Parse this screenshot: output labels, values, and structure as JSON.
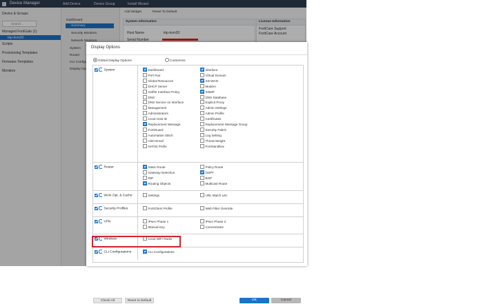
{
  "topbar": {
    "app_title": "Device Manager",
    "menus": [
      "Add Device",
      "Device Group",
      "Install Wizard"
    ]
  },
  "leftnav": {
    "group_header": "Device & Groups",
    "search_placeholder": "Search...",
    "managed": "Managed FortiGate (1)",
    "device": "trip-kvm20",
    "items": [
      "Scripts",
      "Provisioning Templates",
      "Firmware Templates",
      "Monitors"
    ]
  },
  "midnav": {
    "header": "Dashboard",
    "selected": "Summary",
    "items": [
      "Security Monitors",
      "Network Monitors",
      "System",
      "Router",
      "CLI Configurations",
      "Display Options"
    ]
  },
  "content": {
    "add_widget": "Add Widget",
    "reset": "Reset To Default",
    "sysinfo_title": "System Information",
    "host_label": "Host Name",
    "host_value": "trip-kvm20",
    "serial_label": "Serial Number",
    "license_title": "License Information",
    "fortcare_support": "FortiCare Support",
    "fortcare_account": "FortiCare Account"
  },
  "dialog": {
    "title": "Display Options",
    "radio_global": "Global Display Options",
    "radio_custom": "Customize",
    "categories": [
      {
        "name": "System",
        "checked": true,
        "col1": [
          {
            "label": "Dashboard",
            "checked": true
          },
          {
            "label": "Port Pair",
            "checked": false
          },
          {
            "label": "Global Resources",
            "checked": false
          },
          {
            "label": "DHCP Server",
            "checked": false
          },
          {
            "label": "Sniffer Interface Policy",
            "checked": false
          },
          {
            "label": "DNS",
            "checked": false
          },
          {
            "label": "DNS Service on Interface",
            "checked": false
          },
          {
            "label": "Management",
            "checked": false
          },
          {
            "label": "Administrators",
            "checked": false
          },
          {
            "label": "Local Host ID",
            "checked": false
          },
          {
            "label": "Replacement Message",
            "checked": true
          },
          {
            "label": "FortiGuard",
            "checked": false
          },
          {
            "label": "Automation Stitch",
            "checked": false
          },
          {
            "label": "Alert Email",
            "checked": false
          },
          {
            "label": "NAT64 Prefix",
            "checked": false
          }
        ],
        "col2": [
          {
            "label": "Interface",
            "checked": true
          },
          {
            "label": "Virtual Domain",
            "checked": false
          },
          {
            "label": "SD-WAN",
            "checked": true
          },
          {
            "label": "Modem",
            "checked": false
          },
          {
            "label": "SNMP",
            "checked": true
          },
          {
            "label": "DNS Database",
            "checked": false
          },
          {
            "label": "Explicit Proxy",
            "checked": false
          },
          {
            "label": "Admin Settings",
            "checked": false
          },
          {
            "label": "Admin Profile",
            "checked": false
          },
          {
            "label": "Certificates",
            "checked": false
          },
          {
            "label": "Replacement Message Group",
            "checked": false
          },
          {
            "label": "Security Fabric",
            "checked": false
          },
          {
            "label": "Log Setting",
            "checked": false
          },
          {
            "label": "Threat Weight",
            "checked": false
          },
          {
            "label": "FortiSandbox",
            "checked": false
          }
        ]
      },
      {
        "name": "Router",
        "checked": true,
        "col1": [
          {
            "label": "Static Route",
            "checked": true
          },
          {
            "label": "Gateway Detection",
            "checked": false
          },
          {
            "label": "RIP",
            "checked": false
          },
          {
            "label": "Routing Objects",
            "checked": true
          }
        ],
        "col2": [
          {
            "label": "Policy Route",
            "checked": false
          },
          {
            "label": "OSPF",
            "checked": true
          },
          {
            "label": "BGP",
            "checked": false
          },
          {
            "label": "Multicast Route",
            "checked": false
          }
        ]
      },
      {
        "name": "WAN Opt. & Cache",
        "checked": true,
        "col1": [
          {
            "label": "Settings",
            "checked": false
          }
        ],
        "col2": [
          {
            "label": "URL Match List",
            "checked": false
          }
        ]
      },
      {
        "name": "Security Profiles",
        "checked": true,
        "col1": [
          {
            "label": "FortiClient Profile",
            "checked": false
          }
        ],
        "col2": [
          {
            "label": "Web Filter Override",
            "checked": false
          }
        ]
      },
      {
        "name": "VPN",
        "checked": true,
        "col1": [
          {
            "label": "IPsec Phase 1",
            "checked": false
          },
          {
            "label": "Manual Key",
            "checked": false
          }
        ],
        "col2": [
          {
            "label": "IPsec Phase 2",
            "checked": false
          },
          {
            "label": "Concentrator",
            "checked": false
          }
        ]
      },
      {
        "name": "Wireless",
        "checked": true,
        "col1": [
          {
            "label": "Local WiFi Radio",
            "checked": false
          }
        ],
        "col2": []
      },
      {
        "name": "CLI Configurations",
        "checked": true,
        "col1": [
          {
            "label": "CLI Configurations",
            "checked": true
          }
        ],
        "col2": []
      }
    ],
    "buttons": {
      "check_all": "Check All",
      "reset": "Reset to Default",
      "ok": "OK",
      "cancel": "Cancel"
    }
  },
  "colors": {
    "accent": "#1a74c7",
    "highlight": "#d9202a",
    "topbar": "#2e3b4e"
  }
}
